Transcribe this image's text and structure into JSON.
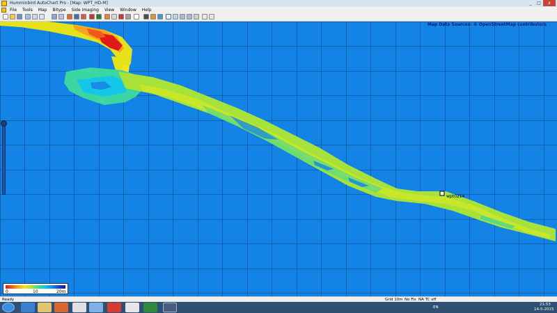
{
  "window": {
    "title": "Humminbird AutoChart Pro - [Map: WPT_HD-M]",
    "buttons": {
      "minimize": "_",
      "maximize": "□",
      "close": "x"
    }
  },
  "menubar": {
    "items": [
      "File",
      "Tools",
      "Map",
      "Bitype",
      "Side Imaging",
      "View",
      "Window",
      "Help"
    ]
  },
  "map": {
    "attribution": "Map Data Sources: © OpenStreetMap contributors",
    "waypoint_label": "wpt0214",
    "water_color": "#1383e6"
  },
  "depth_legend": {
    "labels": [
      "0",
      "10",
      "20m"
    ],
    "gradient": [
      "#e2191b",
      "#f9a21b",
      "#f3e51e",
      "#a6e23a",
      "#3bd6a1",
      "#15c7e6",
      "#1b3dc4",
      "#1a1d88"
    ]
  },
  "statusbar": {
    "left": "Ready",
    "grid": "Grid 10m",
    "fix": "No Fix",
    "na": "NA  TC off"
  },
  "taskbar": {
    "lang": "EN",
    "time": "21:53",
    "date": "14-5-2015"
  }
}
